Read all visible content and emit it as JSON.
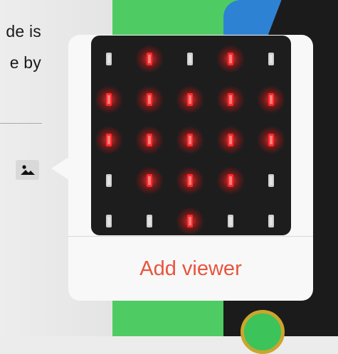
{
  "doc": {
    "line1": "de is",
    "line2": "e by"
  },
  "popover": {
    "action_label": "Add viewer",
    "accent_color": "#e8543d"
  },
  "led_grid": {
    "rows": 5,
    "cols": 5,
    "states": [
      [
        0,
        1,
        0,
        1,
        0
      ],
      [
        1,
        1,
        1,
        1,
        1
      ],
      [
        1,
        1,
        1,
        1,
        1
      ],
      [
        0,
        1,
        1,
        1,
        0
      ],
      [
        0,
        0,
        1,
        0,
        0
      ]
    ],
    "on_color": "#ff2a2a",
    "off_color": "#cfcfcf"
  },
  "icons": {
    "image_button": "image-icon"
  }
}
